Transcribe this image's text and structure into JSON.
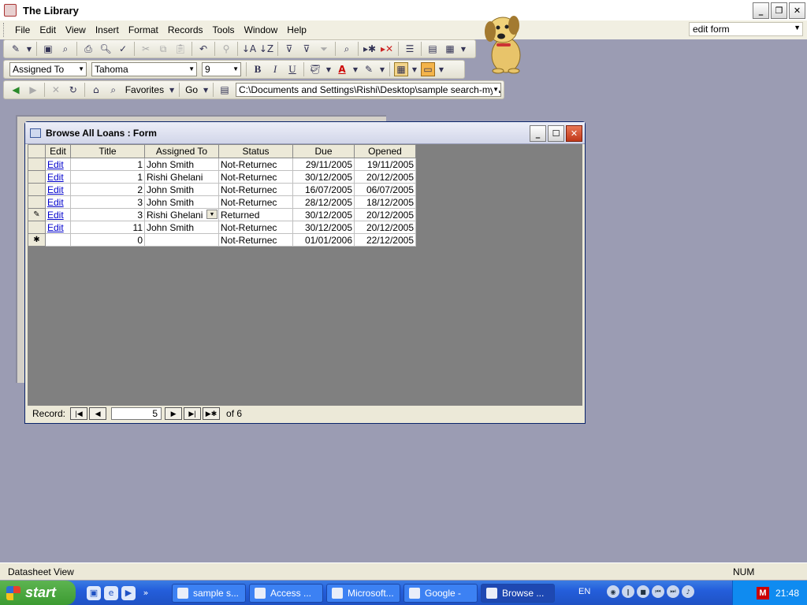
{
  "app": {
    "title": "The Library"
  },
  "menu": [
    "File",
    "Edit",
    "View",
    "Insert",
    "Format",
    "Records",
    "Tools",
    "Window",
    "Help"
  ],
  "help_box": {
    "value": "edit form"
  },
  "formatting": {
    "field": "Assigned To",
    "font": "Tahoma",
    "size": "9",
    "bold": "B",
    "italic": "I",
    "underline": "U"
  },
  "web": {
    "favorites": "Favorites",
    "go": "Go",
    "address": "C:\\Documents and Settings\\Rishi\\Desktop\\sample search-my versic"
  },
  "form": {
    "title": "Browse All Loans : Form",
    "columns": [
      "Edit",
      "Title",
      "Assigned To",
      "Status",
      "Due",
      "Opened"
    ],
    "rows": [
      {
        "selector": "",
        "edit": "Edit",
        "title": "1",
        "assigned": "John Smith",
        "status": "Not-Returnec",
        "due": "29/11/2005",
        "opened": "19/11/2005"
      },
      {
        "selector": "",
        "edit": "Edit",
        "title": "1",
        "assigned": "Rishi Ghelani",
        "status": "Not-Returnec",
        "due": "30/12/2005",
        "opened": "20/12/2005"
      },
      {
        "selector": "",
        "edit": "Edit",
        "title": "2",
        "assigned": "John Smith",
        "status": "Not-Returnec",
        "due": "16/07/2005",
        "opened": "06/07/2005"
      },
      {
        "selector": "",
        "edit": "Edit",
        "title": "3",
        "assigned": "John Smith",
        "status": "Not-Returnec",
        "due": "28/12/2005",
        "opened": "18/12/2005"
      },
      {
        "selector": "✎",
        "edit": "Edit",
        "title": "3",
        "assigned": "Rishi Ghelani",
        "status": "Returned",
        "due": "30/12/2005",
        "opened": "20/12/2005"
      },
      {
        "selector": "",
        "edit": "Edit",
        "title": "11",
        "assigned": "John Smith",
        "status": "Not-Returnec",
        "due": "30/12/2005",
        "opened": "20/12/2005"
      },
      {
        "selector": "✱",
        "edit": "",
        "title": "0",
        "assigned": "",
        "status": "Not-Returnec",
        "due": "01/01/2006",
        "opened": "22/12/2005"
      }
    ],
    "nav": {
      "label": "Record:",
      "current": "5",
      "of_label": "of 6"
    }
  },
  "statusbar": {
    "left": "Datasheet View",
    "num": "NUM"
  },
  "taskbar": {
    "start": "start",
    "items": [
      "sample s...",
      "Access ...",
      "Microsoft...",
      "Google -",
      "Browse ..."
    ],
    "lang": "EN",
    "clock": "21:48"
  },
  "icons": {
    "app": "access-key-icon",
    "assistant": "rocky-dog-icon"
  }
}
